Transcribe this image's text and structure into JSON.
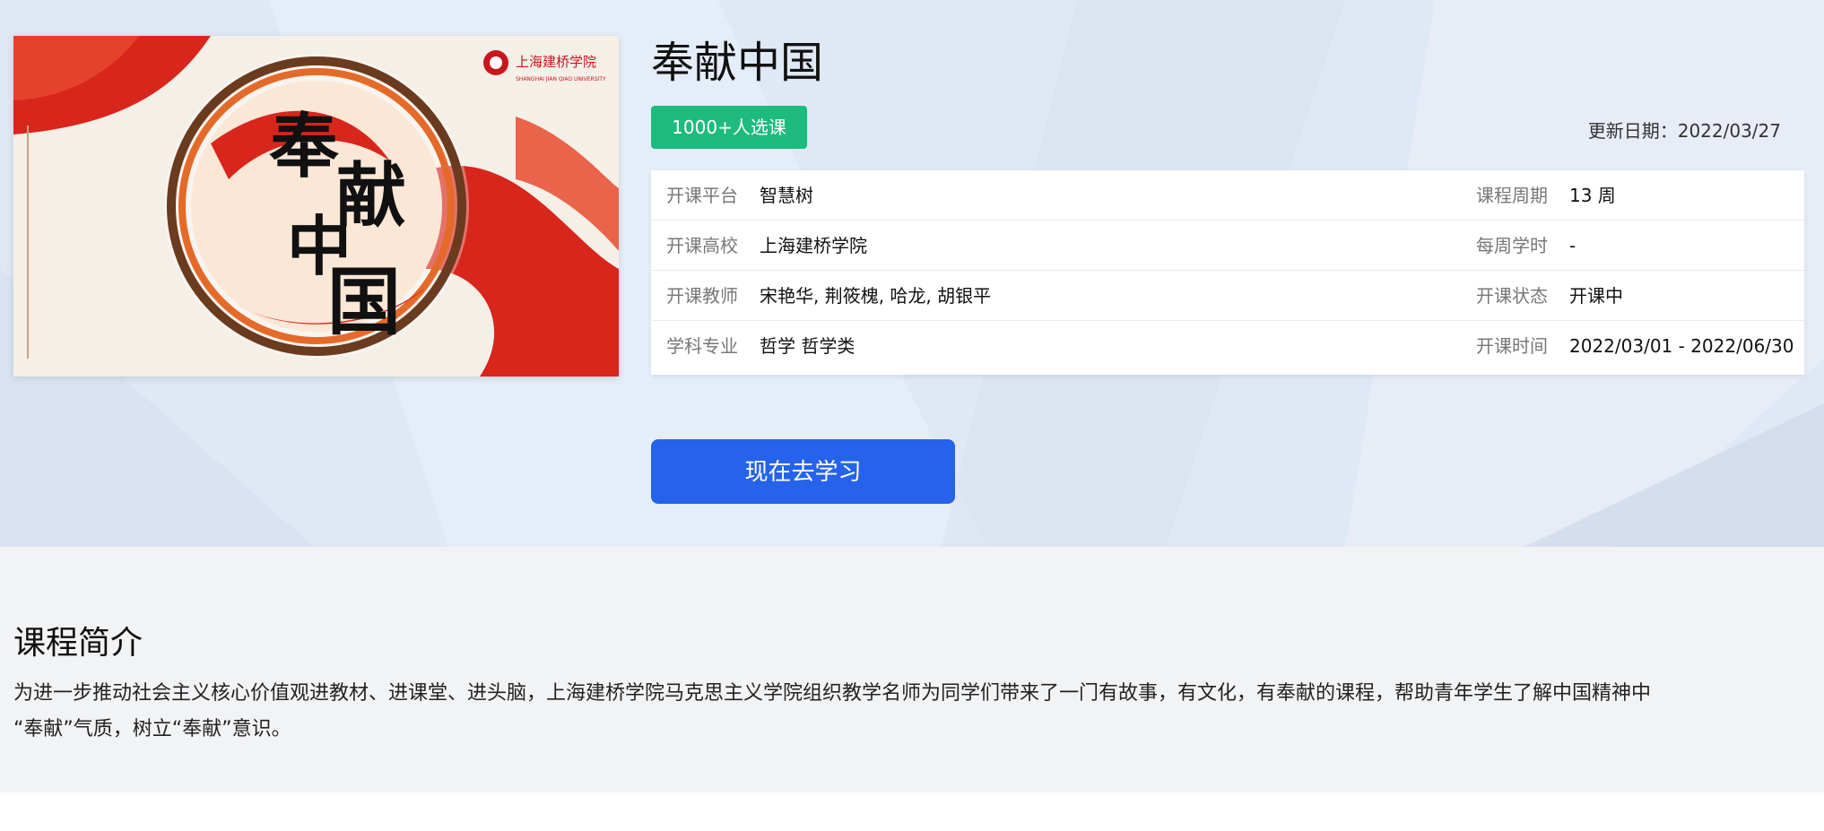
{
  "course": {
    "title": "奉献中国",
    "enroll_badge": "1000+人选课",
    "update_label": "更新日期：",
    "update_date": "2022/03/27",
    "cover": {
      "calligraphy": [
        "奉",
        "献",
        "中",
        "国"
      ],
      "logo_text": "上海建桥学院",
      "logo_subtext": "SHANGHAI JIAN QIAO UNIVERSITY"
    }
  },
  "info": {
    "rows": [
      {
        "left_label": "开课平台",
        "left_value": "智慧树",
        "right_label": "课程周期",
        "right_value": "13 周"
      },
      {
        "left_label": "开课高校",
        "left_value": "上海建桥学院",
        "right_label": "每周学时",
        "right_value": "-"
      },
      {
        "left_label": "开课教师",
        "left_value": "宋艳华, 荆筱槐, 哈龙, 胡银平",
        "right_label": "开课状态",
        "right_value": "开课中"
      },
      {
        "left_label": "学科专业",
        "left_value": "哲学 哲学类",
        "right_label": "开课时间",
        "right_value": "2022/03/01 - 2022/06/30"
      }
    ]
  },
  "actions": {
    "study_label": "现在去学习"
  },
  "intro": {
    "title": "课程简介",
    "line1": "为进一步推动社会主义核心价值观进教材、进课堂、进头脑，上海建桥学院马克思主义学院组织教学名师为同学们带来了一门有故事，有文化，有奉献的课程，帮助青年学生了解中国精神中",
    "line2": "“奉献”气质，树立“奉献”意识。"
  },
  "colors": {
    "badge_green": "#1dbb7e",
    "button_blue": "#2563eb",
    "hero_bg": "#dfe8f5",
    "intro_bg": "#f2f3f5"
  }
}
